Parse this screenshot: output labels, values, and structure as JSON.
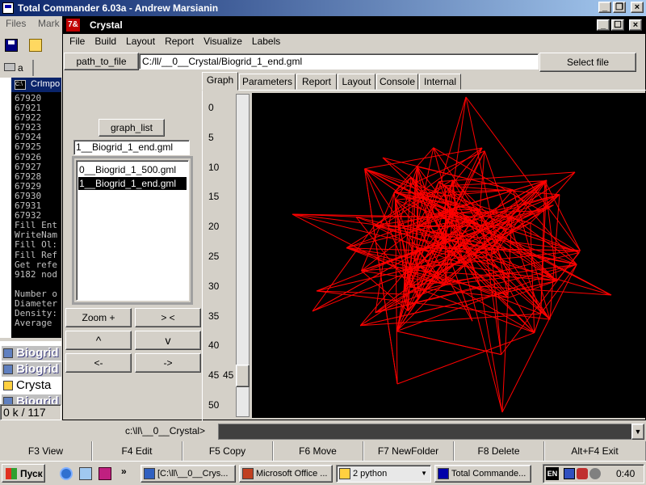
{
  "tc": {
    "title": "Total Commander 6.03a - Andrew Marsianin",
    "menu": [
      "Files",
      "Mark"
    ],
    "drive_label": "a",
    "log_tab": "CrImpo",
    "numbers": [
      "67920",
      "67921",
      "67922",
      "67923",
      "67924",
      "67925",
      "67926",
      "67927",
      "67928",
      "67929",
      "67930",
      "67931",
      "67932"
    ],
    "log_lines": [
      "Fill Ent",
      "WriteNam",
      "Fill Ol:",
      "Fill Ref",
      "Get refe",
      "9182 nod",
      "",
      "Number o",
      "Diameter",
      "Density:",
      "Average"
    ],
    "files": [
      "Biogrid",
      "Biogrid",
      "Crysta",
      "Biogrid"
    ],
    "status": "0 k / 117",
    "cmd_path": "c:\\ll\\__0__Crystal>",
    "fkeys": [
      "F3 View",
      "F4 Edit",
      "F5 Copy",
      "F6 Move",
      "F7 NewFolder",
      "F8 Delete",
      "Alt+F4 Exit"
    ]
  },
  "crystal": {
    "app_icon": "7&",
    "title": "Crystal",
    "menu": [
      "File",
      "Build",
      "Layout",
      "Report",
      "Visualize",
      "Labels"
    ],
    "path_button": "path_to_file",
    "path_value": "C:/ll/__0__Crystal/Biogrid_1_end.gml",
    "select_button": "Select file",
    "graph_list_button": "graph_list",
    "graph_list_value": "1__Biogrid_1_end.gml",
    "graph_items": [
      "0__Biogrid_1_500.gml",
      "1__Biogrid_1_end.gml"
    ],
    "selected_index": 1,
    "nav_buttons": [
      "Zoom +",
      "> <",
      "^",
      "v",
      "<-",
      "->"
    ],
    "tabs": [
      "Graph",
      "Parameters",
      "Report",
      "Layout",
      "Console",
      "Internal"
    ],
    "active_tab": "Graph",
    "ruler": [
      "0",
      "5",
      "10",
      "15",
      "20",
      "25",
      "30",
      "35",
      "40",
      "45",
      "50"
    ],
    "slider_value": "45",
    "slider_level": 0.9,
    "graph_color": "#ff0000",
    "graph_bg": "#000000"
  },
  "taskbar": {
    "start": "Пуск",
    "tasks": [
      "[C:\\ll\\__0__Crys...",
      "Microsoft Office ...",
      "2 python",
      "Total Commande..."
    ],
    "lang": "EN",
    "time": "0:40"
  }
}
